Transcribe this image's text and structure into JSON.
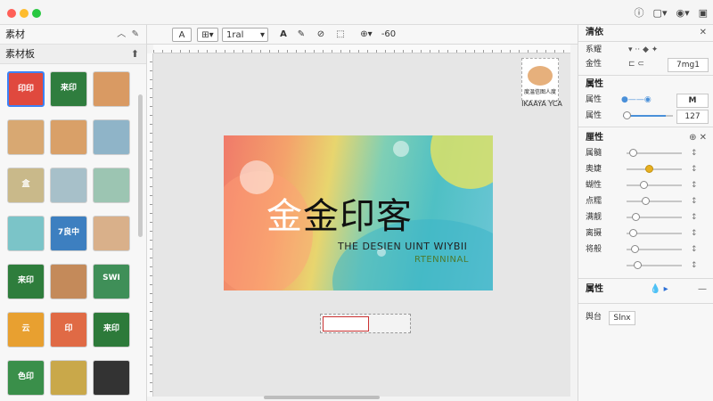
{
  "window": {
    "traffic_colors": [
      "#ff5f57",
      "#febc2e",
      "#28c840"
    ]
  },
  "topright": {
    "icons": [
      "help-icon",
      "chat-icon",
      "user-icon",
      "panel-icon"
    ]
  },
  "left": {
    "header": "素材",
    "subheader": "素材板",
    "thumbs": [
      {
        "label": "印印",
        "color": "#e0493e"
      },
      {
        "label": "来印",
        "color": "#2f7d3e"
      },
      {
        "label": "",
        "color": "#d99a63"
      },
      {
        "label": "",
        "color": "#d8a872"
      },
      {
        "label": "",
        "color": "#d9a068"
      },
      {
        "label": "",
        "color": "#8fb4c8"
      },
      {
        "label": "盒",
        "color": "#c9b98a"
      },
      {
        "label": "",
        "color": "#a7c0c9"
      },
      {
        "label": "",
        "color": "#9cc5b2"
      },
      {
        "label": "",
        "color": "#7bc4c8"
      },
      {
        "label": "7良中",
        "color": "#3d7fc0"
      },
      {
        "label": "",
        "color": "#d9b08a"
      },
      {
        "label": "来印",
        "color": "#2e7d3c"
      },
      {
        "label": "",
        "color": "#c48a5a"
      },
      {
        "label": "SWI",
        "color": "#3f8f58"
      },
      {
        "label": "云",
        "color": "#e8a030"
      },
      {
        "label": "印",
        "color": "#e06a45"
      },
      {
        "label": "来印",
        "color": "#2d7a3a"
      },
      {
        "label": "色印",
        "color": "#3a8f4a"
      },
      {
        "label": "",
        "color": "#c9a84a"
      },
      {
        "label": "",
        "color": "#333333"
      }
    ]
  },
  "toolbar": {
    "tool_text": "A",
    "font_name": "1ral",
    "zoom": "-60"
  },
  "canvas": {
    "card": {
      "title_first": "金",
      "title_rest": "金印客",
      "subtitle": "THE DESIEN UINT WIYBII",
      "subtitle2": "RTENNINAL"
    },
    "preview_caption": "IKAAYA YCA",
    "preview_sub": "度温信图人度"
  },
  "right": {
    "header": "清依",
    "row1_label": "系耀",
    "row2_label": "金性",
    "row2_value": "7mg1",
    "section1": "属性",
    "s1_row1": "属性",
    "s1_row1_value": "M",
    "s1_row2": "属性",
    "s1_row2_value": "127",
    "section2": "厘性",
    "props": [
      {
        "label": "属髓",
        "level": 0.05
      },
      {
        "label": "奥婕",
        "level": 0.4
      },
      {
        "label": "蝴性",
        "level": 0.28
      },
      {
        "label": "点糯",
        "level": 0.32
      },
      {
        "label": "满靓",
        "level": 0.12
      },
      {
        "label": "离摄",
        "level": 0.06
      },
      {
        "label": "将般",
        "level": 0.1
      },
      {
        "label": "",
        "level": 0.15
      }
    ],
    "section3": "属性",
    "footer_label": "舆台",
    "footer_value": "Slnx"
  }
}
